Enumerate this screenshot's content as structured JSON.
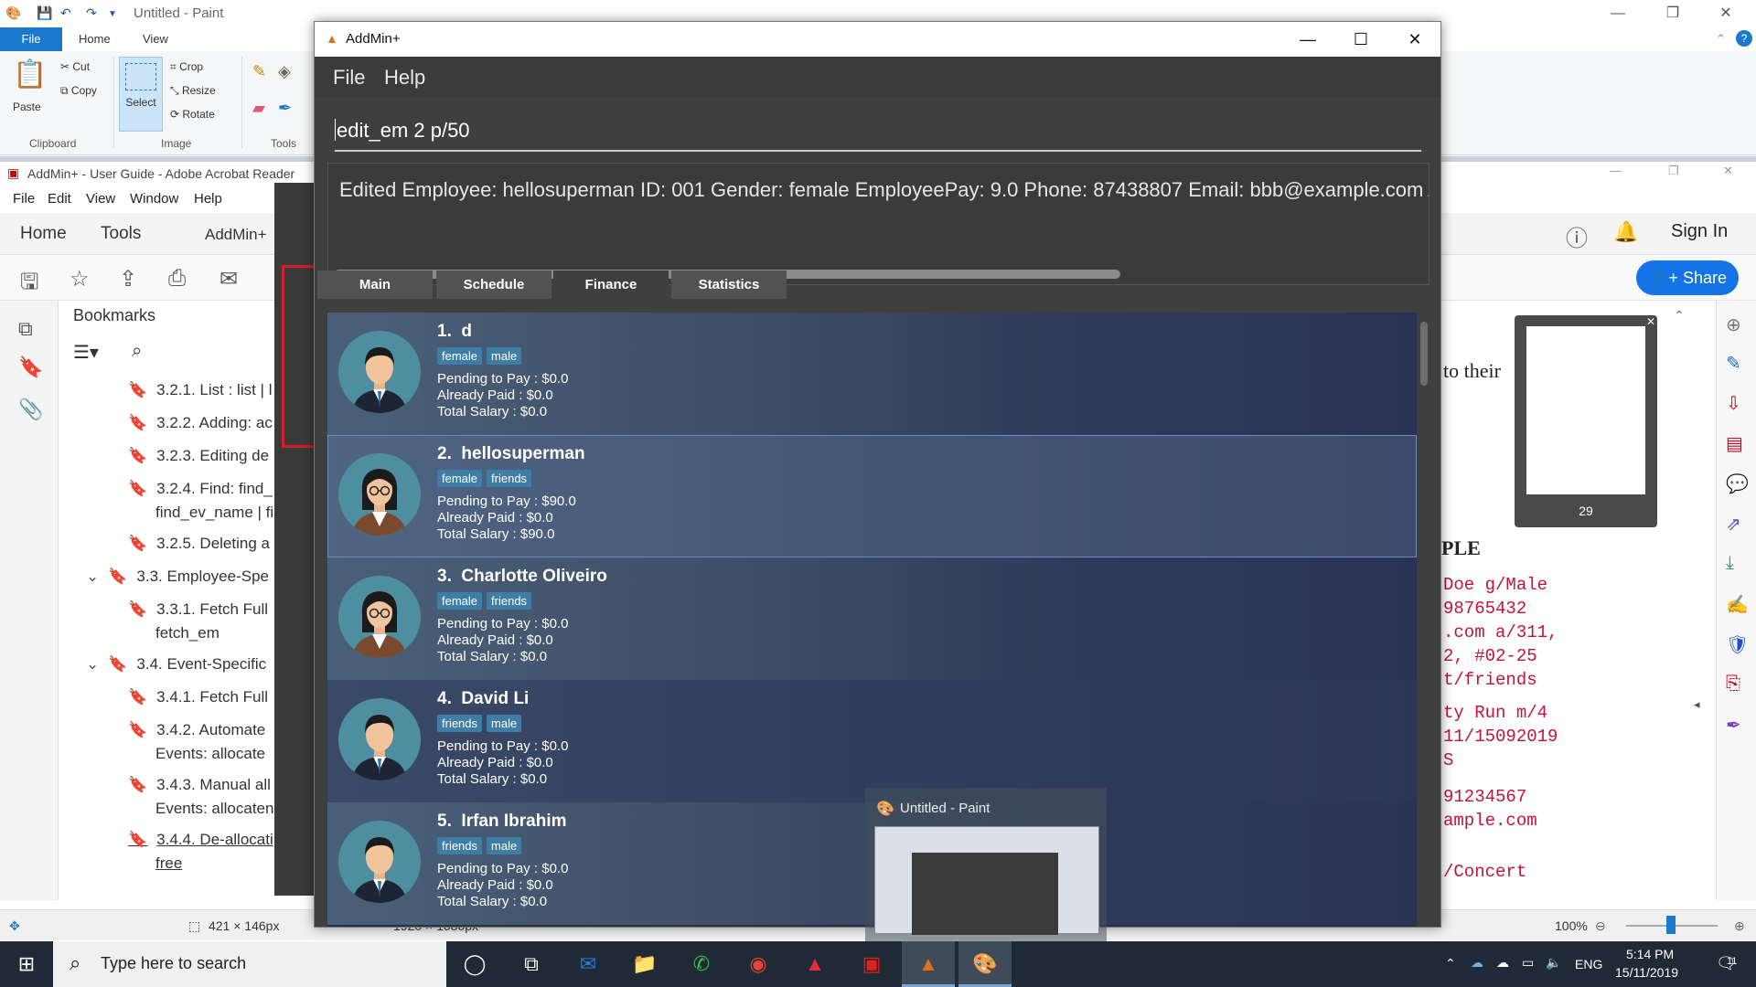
{
  "paint": {
    "title": "Untitled - Paint",
    "tabs": {
      "file": "File",
      "home": "Home",
      "view": "View"
    },
    "ribbon": {
      "paste": "Paste",
      "cut": "Cut",
      "copy": "Copy",
      "select": "Select",
      "crop": "Crop",
      "resize": "Resize",
      "rotate": "Rotate",
      "groups": {
        "clipboard": "Clipboard",
        "image": "Image",
        "tools": "Tools"
      }
    },
    "status": {
      "selection": "421 × 146px",
      "canvas": "1920 × 1080px",
      "zoom": "100%"
    }
  },
  "acrobat": {
    "title": "AddMin+ - User Guide - Adobe Acrobat Reader",
    "menu": [
      "File",
      "Edit",
      "View",
      "Window",
      "Help"
    ],
    "bar": {
      "home": "Home",
      "tools": "Tools",
      "doc_tab": "AddMin+",
      "sign_in": "Sign In"
    },
    "share": "Share",
    "bookmarks_title": "Bookmarks",
    "bookmarks": [
      "3.2.1. List : list | l",
      "3.2.2. Adding: ac",
      "3.2.3. Editing de",
      "3.2.4. Find: find_",
      "find_ev_name | fi",
      "3.2.5. Deleting a",
      "3.3. Employee-Spe",
      "3.3.1. Fetch Full",
      "fetch_em",
      "3.4. Event-Specific",
      "3.4.1. Fetch Full",
      "3.4.2. Automate",
      "Events: allocate",
      "3.4.3. Manual all",
      "Events: allocaten",
      "3.4.4. De-allocati",
      "free"
    ],
    "page_text": {
      "to_their": "to their",
      "heading": "PLE",
      "lines": [
        "Doe g/Male",
        "98765432",
        ".com a/311,",
        "2, #02-25",
        "t/friends",
        "ty Run m/4",
        "11/15092019",
        "S",
        "91234567",
        "ample.com",
        "/Concert"
      ]
    },
    "thumbnail_page": "29"
  },
  "addmin": {
    "title": "AddMin+",
    "menu": {
      "file": "File",
      "help": "Help"
    },
    "command_value": "edit_em 2 p/50",
    "result": "Edited Employee: hellosuperman ID: 001 Gender: female EmployeePay: 9.0 Phone: 87438807 Email: bbb@example.com Address: Bl",
    "tabs": [
      "Main",
      "Schedule",
      "Finance",
      "Statistics"
    ],
    "active_tab": "Finance",
    "labels": {
      "pending": "Pending to Pay : ",
      "paid": "Already Paid : ",
      "total": "Total Salary : "
    },
    "employees": [
      {
        "index": "1.",
        "name": "d",
        "tags": [
          "female",
          "male"
        ],
        "pending": "$0.0",
        "paid": "$0.0",
        "total": "$0.0",
        "avatar": "male"
      },
      {
        "index": "2.",
        "name": "hellosuperman",
        "tags": [
          "female",
          "friends"
        ],
        "pending": "$90.0",
        "paid": "$0.0",
        "total": "$90.0",
        "avatar": "female"
      },
      {
        "index": "3.",
        "name": "Charlotte Oliveiro",
        "tags": [
          "female",
          "friends"
        ],
        "pending": "$0.0",
        "paid": "$0.0",
        "total": "$0.0",
        "avatar": "female"
      },
      {
        "index": "4.",
        "name": "David Li",
        "tags": [
          "friends",
          "male"
        ],
        "pending": "$0.0",
        "paid": "$0.0",
        "total": "$0.0",
        "avatar": "male"
      },
      {
        "index": "5.",
        "name": "Irfan Ibrahim",
        "tags": [
          "friends",
          "male"
        ],
        "pending": "$0.0",
        "paid": "$0.0",
        "total": "$0.0",
        "avatar": "male"
      }
    ]
  },
  "preview": {
    "title": "Untitled - Paint"
  },
  "taskbar": {
    "search_placeholder": "Type here to search",
    "language": "ENG",
    "time": "5:14 PM",
    "date": "15/11/2019",
    "notifications": "11"
  },
  "colors": {
    "accent": "#1979ca",
    "tag": "#3e7ea6",
    "share": "#1473e6",
    "pdf_text": "#c0143c"
  }
}
